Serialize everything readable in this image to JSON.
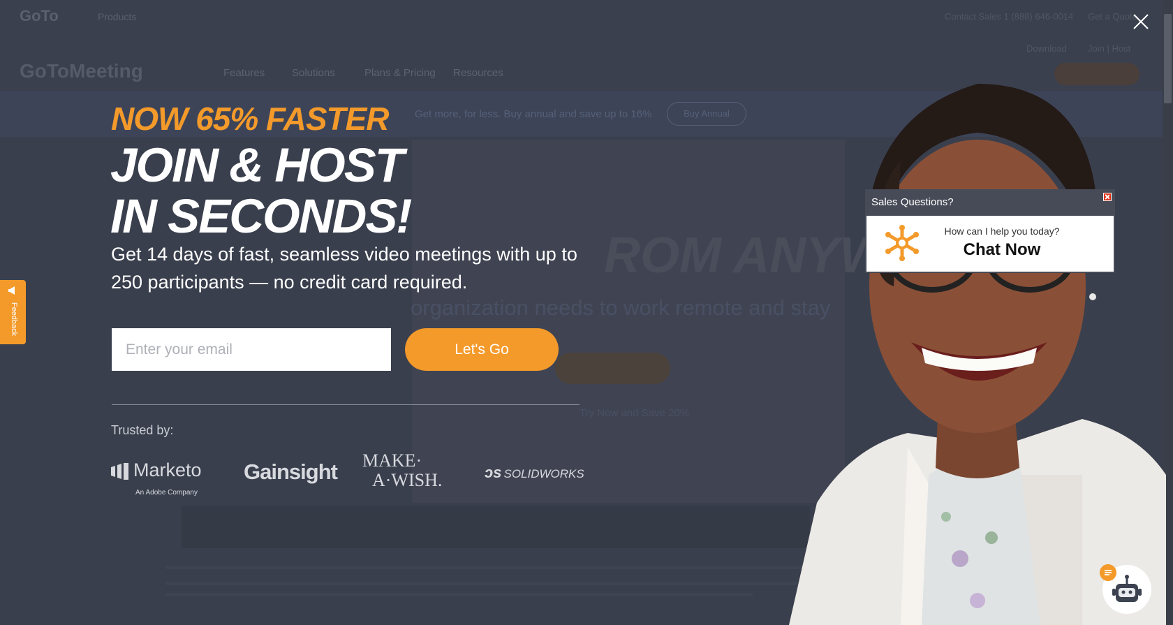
{
  "background_page": {
    "logo": "GoTo",
    "products_menu": "Products",
    "contact_sales": "Contact Sales 1 (888) 646-0014",
    "get_quote": "Get a Quote",
    "download": "Download",
    "join_host": "Join | Host",
    "product_logo": "GoToMeeting",
    "nav": [
      "Features",
      "Solutions",
      "Plans & Pricing",
      "Resources"
    ],
    "promo_text": "Get more, for less. Buy annual and save up to 16%",
    "promo_button": "Buy Annual",
    "hero_title": "ROM ANYWHERE",
    "hero_subtitle": "organization needs to work remote and stay",
    "hero_note": "Try Now and Save 20%"
  },
  "feedback": {
    "label": "Feedback"
  },
  "modal": {
    "eyebrow": "NOW 65% FASTER",
    "headline_line1": "JOIN & HOST",
    "headline_line2": "IN SECONDS!",
    "subtext": "Get 14 days of fast, seamless video meetings with up to 250 participants — no credit card required.",
    "email_placeholder": "Enter your email",
    "submit_label": "Let's Go",
    "trusted_label": "Trusted by:",
    "logos": {
      "marketo": "Marketo",
      "marketo_sub": "An Adobe Company",
      "gainsight": "Gainsight",
      "makewish_line1": "MAKE·",
      "makewish_line2": "A·WISH.",
      "solidworks": "SOLIDWORKS"
    }
  },
  "chat": {
    "header": "Sales Questions?",
    "question": "How can I help you today?",
    "cta": "Chat Now"
  },
  "colors": {
    "accent": "#f39a2b",
    "overlay": "#3a3f4d",
    "chat_header": "#474b57"
  }
}
